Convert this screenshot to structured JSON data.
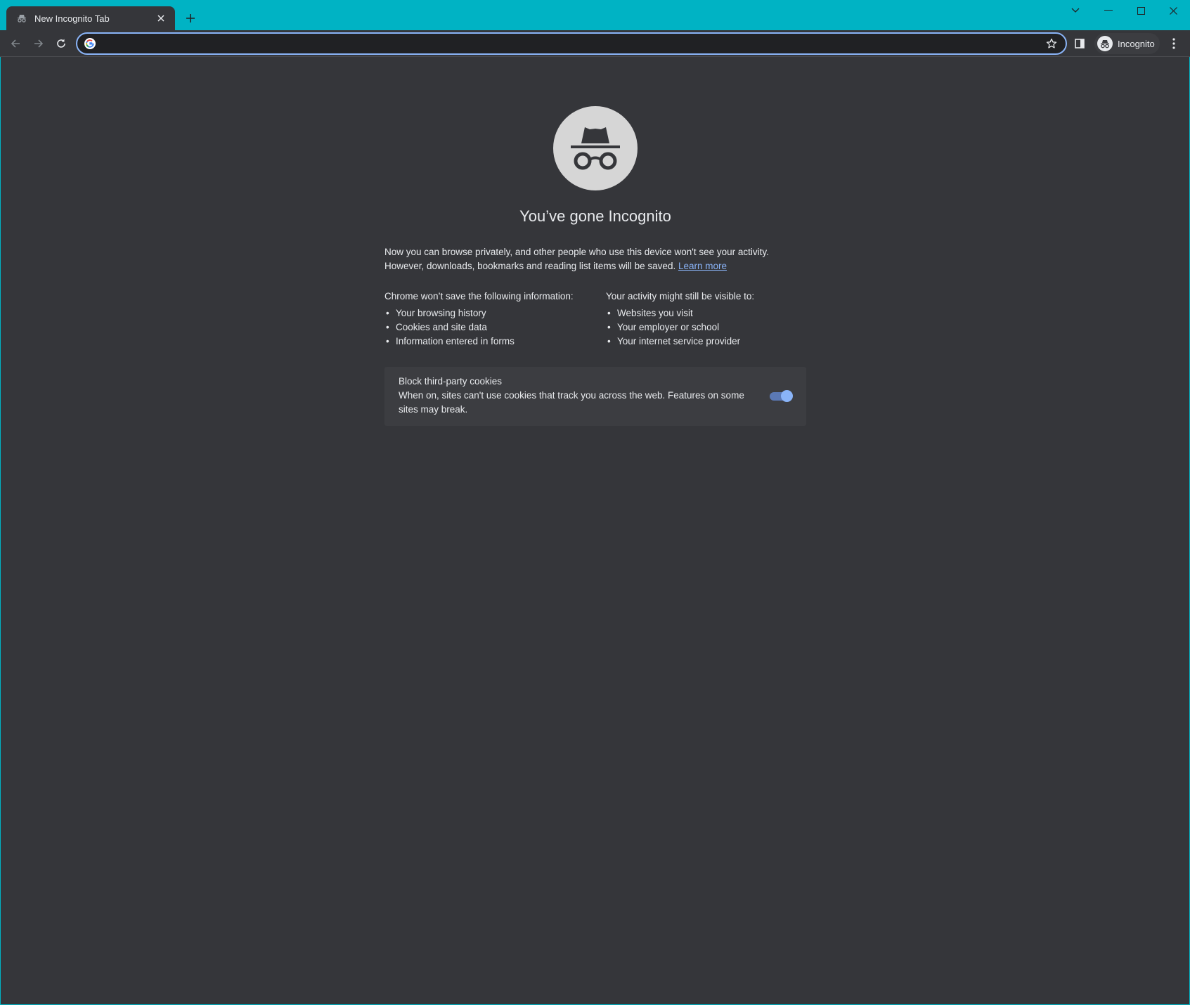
{
  "tab": {
    "title": "New Incognito Tab"
  },
  "toolbar": {
    "address_value": "",
    "profile_label": "Incognito"
  },
  "page": {
    "heading": "You’ve gone Incognito",
    "intro_line1": "Now you can browse privately, and other people who use this device won't see your activity.",
    "intro_line2": "However, downloads, bookmarks and reading list items will be saved.",
    "learn_more": "Learn more",
    "left_heading": "Chrome won’t save the following information:",
    "left_items": [
      "Your browsing history",
      "Cookies and site data",
      "Information entered in forms"
    ],
    "right_heading": "Your activity might still be visible to:",
    "right_items": [
      "Websites you visit",
      "Your employer or school",
      "Your internet service provider"
    ],
    "cookies_title": "Block third-party cookies",
    "cookies_desc": "When on, sites can't use cookies that track you across the web. Features on some sites may break.",
    "cookies_toggle_on": true
  },
  "colors": {
    "frame": "#00b3c4",
    "toolbar": "#35363a",
    "content": "#35363a",
    "accent": "#8ab4f8"
  },
  "icons": [
    "incognito-icon",
    "close-icon",
    "plus-icon",
    "chevron-down-icon",
    "minimize-icon",
    "maximize-icon",
    "back-arrow-icon",
    "forward-arrow-icon",
    "reload-icon",
    "google-icon",
    "star-icon",
    "side-panel-icon",
    "kebab-menu-icon"
  ]
}
